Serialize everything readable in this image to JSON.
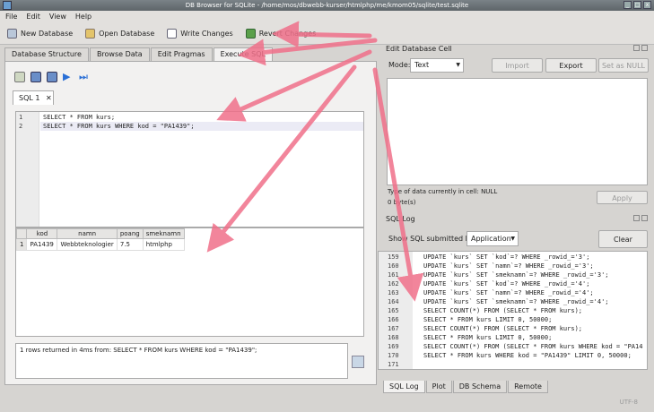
{
  "window": {
    "title": "DB Browser for SQLite - /home/mos/dbwebb-kurser/htmlphp/me/kmom05/sqlite/test.sqlite"
  },
  "menu": [
    "File",
    "Edit",
    "View",
    "Help"
  ],
  "toolbar": {
    "new_db": "New Database",
    "open_db": "Open Database",
    "write": "Write Changes",
    "revert": "Revert Changes"
  },
  "tabs": [
    "Database Structure",
    "Browse Data",
    "Edit Pragmas",
    "Execute SQL"
  ],
  "sql_tab": "SQL 1",
  "editor": {
    "line1": "SELECT * FROM kurs;",
    "line2": "SELECT * FROM kurs WHERE kod = \"PA1439\";"
  },
  "results": {
    "columns": [
      "kod",
      "namn",
      "poang",
      "smeknamn"
    ],
    "rows": [
      [
        "1",
        "PA1439",
        "Webbteknologier",
        "7.5",
        "htmlphp"
      ]
    ]
  },
  "message": "1 rows returned in 4ms from: SELECT * FROM kurs WHERE kod = \"PA1439\";",
  "edit_cell": {
    "title": "Edit Database Cell",
    "mode_label": "Mode:",
    "mode_value": "Text",
    "import": "Import",
    "export": "Export",
    "set_null": "Set as NULL",
    "type_info": "Type of data currently in cell: NULL",
    "size_info": "0 byte(s)",
    "apply": "Apply"
  },
  "sql_log": {
    "title": "SQL Log",
    "show_label": "Show SQL submitted by",
    "source": "Application",
    "clear": "Clear",
    "lines": [
      {
        "n": "159",
        "t": "UPDATE `kurs` SET `kod`=? WHERE _rowid_='3';"
      },
      {
        "n": "160",
        "t": "UPDATE `kurs` SET `namn`=? WHERE _rowid_='3';"
      },
      {
        "n": "161",
        "t": "UPDATE `kurs` SET `smeknamn`=? WHERE _rowid_='3';"
      },
      {
        "n": "162",
        "t": "UPDATE `kurs` SET `kod`=? WHERE _rowid_='4';"
      },
      {
        "n": "163",
        "t": "UPDATE `kurs` SET `namn`=? WHERE _rowid_='4';"
      },
      {
        "n": "164",
        "t": "UPDATE `kurs` SET `smeknamn`=? WHERE _rowid_='4';"
      },
      {
        "n": "165",
        "t": "SELECT COUNT(*) FROM (SELECT * FROM kurs);"
      },
      {
        "n": "166",
        "t": "SELECT * FROM kurs LIMIT 0, 50000;"
      },
      {
        "n": "167",
        "t": "SELECT COUNT(*) FROM (SELECT * FROM kurs);"
      },
      {
        "n": "168",
        "t": "SELECT * FROM kurs LIMIT 0, 50000;"
      },
      {
        "n": "169",
        "t": "SELECT COUNT(*) FROM (SELECT * FROM kurs WHERE kod = \"PA14"
      },
      {
        "n": "170",
        "t": "SELECT * FROM kurs WHERE kod = \"PA1439\" LIMIT 0, 50000;"
      },
      {
        "n": "171",
        "t": ""
      }
    ]
  },
  "bottom_tabs": [
    "SQL Log",
    "Plot",
    "DB Schema",
    "Remote"
  ],
  "status": {
    "encoding": "UTF-8"
  },
  "colors": {
    "accent_arrow": "#f0708a",
    "keyword": "#1418a8",
    "string": "#c81b1b"
  }
}
